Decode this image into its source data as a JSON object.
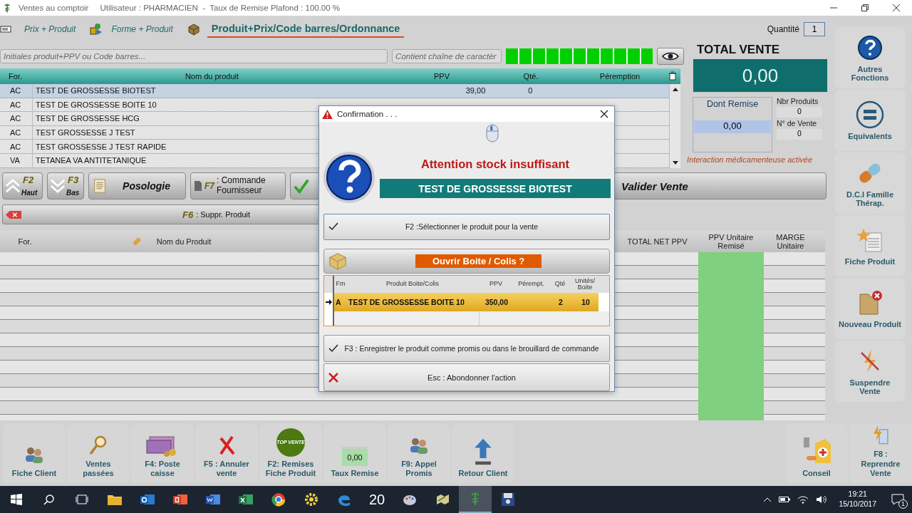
{
  "window": {
    "title": "Ventes au comptoir",
    "user": "Utilisateur : PHARMACIEN  -  Taux de Remise Plafond : 100.00 %"
  },
  "tabs": [
    {
      "label": "Prix + Produit",
      "kind": "price",
      "selected": false
    },
    {
      "label": "Forme + Produit",
      "kind": "form",
      "selected": false
    },
    {
      "label": "Produit+Prix/Code barres/Ordonnance",
      "kind": "box",
      "selected": true
    }
  ],
  "quantity": {
    "label": "Quantité",
    "value": "1"
  },
  "search": {
    "placeholder": "Initiales produit+PPV ou Code barres...",
    "contains_placeholder": "Contient chaîne de caractèr"
  },
  "stock_meter": {
    "level": 1
  },
  "products": {
    "columns": [
      "For.",
      "Nom du produit",
      "PPV",
      "Qté.",
      "Péremption"
    ],
    "rows": [
      {
        "form": "AC",
        "name": "TEST DE GROSSESSE BIOTEST",
        "ppv": "39,00",
        "qty": "0",
        "selected": true
      },
      {
        "form": "AC",
        "name": "TEST DE GROSSESSE BOITE 10",
        "selected": false
      },
      {
        "form": "AC",
        "name": "TEST DE GROSSESSE HCG",
        "selected": false
      },
      {
        "form": "AC",
        "name": "TEST GROSSESSE J TEST",
        "selected": false
      },
      {
        "form": "AC",
        "name": "TEST GROSSESSE J TEST RAPIDE",
        "selected": false
      },
      {
        "form": "VA",
        "name": "TETANEA VA ANTITETANIQUE",
        "selected": false
      }
    ]
  },
  "actions": [
    {
      "kind": "up",
      "key": "F2",
      "label": "Haut"
    },
    {
      "kind": "down",
      "key": "F3",
      "label": "Bas"
    },
    {
      "kind": "dosage",
      "label": "Posologie"
    },
    {
      "kind": "order",
      "key": "F7",
      "label": ": Commande Fournisseur"
    },
    {
      "kind": "validate",
      "label": "Valider Vente"
    }
  ],
  "delete_bar": {
    "key": "F6",
    "label": ": Suppr. Produit"
  },
  "sale_table": {
    "columns": [
      "For.",
      "Nom du Produit",
      "",
      "TOTAL NET PPV",
      "PPV Unitaire Remisé",
      "MARGE Unitaire"
    ]
  },
  "totals": {
    "title": "TOTAL VENTE",
    "total": "0,00",
    "discount_label": "Dont Remise",
    "discount": "0,00",
    "count_label": "Nbr Produits",
    "count": "0",
    "sale_no_label": "N° de Vente",
    "sale_no": "0",
    "interaction_note": "Interaction médicamenteuse activée"
  },
  "sidebar": [
    {
      "kind": "help",
      "label": "Autres Fonctions"
    },
    {
      "kind": "equivalents",
      "label": "Equivalents"
    },
    {
      "kind": "pill",
      "label": "D.C.I Famille Thérap."
    },
    {
      "kind": "card",
      "label": "Fiche Produit"
    },
    {
      "kind": "folder",
      "label": "Nouveau Produit"
    },
    {
      "kind": "suspend",
      "label": "Suspendre Vente"
    }
  ],
  "toolbar": [
    {
      "kind": "people",
      "label": "Fiche Client"
    },
    {
      "kind": "magnifier",
      "label": "Ventes passées"
    },
    {
      "kind": "cash",
      "label": "F4: Poste caisse"
    },
    {
      "kind": "cancel",
      "label": "F5 : Annuler vente"
    },
    {
      "kind": "badge",
      "label": "F2: Remises Fiche Produit",
      "badge": "TOP VENTE"
    },
    {
      "kind": "rate",
      "label": "Taux Remise",
      "value": "0,00"
    },
    {
      "kind": "people",
      "label": "F9: Appel Promis"
    },
    {
      "kind": "return",
      "label": "Retour Client"
    },
    {
      "kind": "spacer"
    },
    {
      "kind": "advice",
      "label": "Conseil"
    },
    {
      "kind": "resume",
      "label": "F8 : Reprendre Vente"
    }
  ],
  "dialog": {
    "title": "Confirmation . . .",
    "heading": "Attention stock insuffisant",
    "product": "TEST DE GROSSESSE BIOTEST",
    "select_option": "F2 :Sélectionner le produit pour la vente",
    "open_box": "Ouvrir Boite / Colis ?",
    "box_table": {
      "columns": [
        "Fm",
        "Produit Boite/Colis",
        "PPV",
        "Pérempt.",
        "Qté",
        "Unités/ Boite"
      ],
      "rows": [
        {
          "form": "A",
          "name": "TEST DE GROSSESSE BOITE 10",
          "ppv": "350,00",
          "qty": "2",
          "units": "10",
          "selected": true
        }
      ]
    },
    "promise_option": "F3 : Enregistrer le produit comme promis ou dans le brouillard de commande",
    "cancel_option": "Esc : Abondonner l'action"
  },
  "taskbar": {
    "apps": [
      {
        "kind": "explorer",
        "active": false
      },
      {
        "kind": "mail",
        "active": false
      },
      {
        "kind": "slides",
        "active": false
      },
      {
        "kind": "doc",
        "active": false
      },
      {
        "kind": "sheet",
        "active": false
      },
      {
        "kind": "browser",
        "active": false
      },
      {
        "kind": "gear",
        "active": false
      },
      {
        "kind": "edge",
        "active": false
      },
      {
        "kind": "number",
        "label": "20",
        "active": false
      },
      {
        "kind": "palette",
        "active": false
      },
      {
        "kind": "map",
        "active": false
      },
      {
        "kind": "pharmacy",
        "active": true
      },
      {
        "kind": "disk",
        "active": false
      }
    ],
    "time": "19:21",
    "date": "15/10/2017",
    "notifications": "1"
  }
}
